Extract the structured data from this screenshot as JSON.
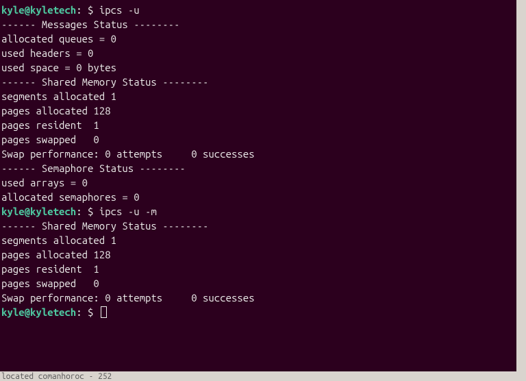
{
  "prompt": {
    "user_host": "kyle@kyletech",
    "colon": ":",
    "path": " ",
    "dollar": "$"
  },
  "cmd1": "ipcs -u",
  "cmd2": "ipcs -u -m",
  "cmd3": "",
  "blank": "",
  "msg": {
    "header": "------ Messages Status --------",
    "l1": "allocated queues = 0",
    "l2": "used headers = 0",
    "l3": "used space = 0 bytes"
  },
  "shm": {
    "header": "------ Shared Memory Status --------",
    "l1": "segments allocated 1",
    "l2": "pages allocated 128",
    "l3": "pages resident  1",
    "l4": "pages swapped   0",
    "l5": "Swap performance: 0 attempts     0 successes"
  },
  "sem": {
    "header": "------ Semaphore Status --------",
    "l1": "used arrays = 0",
    "l2": "allocated semaphores = 0"
  },
  "bottom_strip": "located comanhoroc - 252"
}
